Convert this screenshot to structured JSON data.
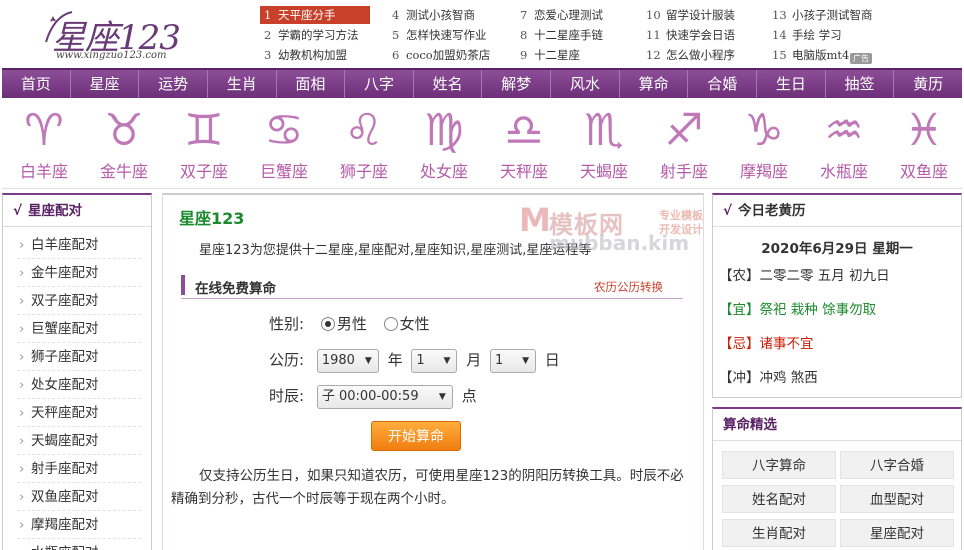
{
  "logo": {
    "text": "星座123",
    "url": "www.xingzuo123.com"
  },
  "top_links": [
    {
      "n": "1",
      "text": "天平座分手"
    },
    {
      "n": "2",
      "text": "学霸的学习方法"
    },
    {
      "n": "3",
      "text": "幼教机构加盟"
    },
    {
      "n": "4",
      "text": "测试小孩智商"
    },
    {
      "n": "5",
      "text": "怎样快速写作业"
    },
    {
      "n": "6",
      "text": "coco加盟奶茶店"
    },
    {
      "n": "7",
      "text": "恋爱心理测试"
    },
    {
      "n": "8",
      "text": "十二星座手链"
    },
    {
      "n": "9",
      "text": "十二星座"
    },
    {
      "n": "10",
      "text": "留学设计服装"
    },
    {
      "n": "11",
      "text": "快速学会日语"
    },
    {
      "n": "12",
      "text": "怎么做小程序"
    },
    {
      "n": "13",
      "text": "小孩子测试智商"
    },
    {
      "n": "14",
      "text": "手绘 学习"
    },
    {
      "n": "15",
      "text": "电脑版mt4"
    }
  ],
  "ad_mark": "广告",
  "nav": [
    "首页",
    "星座",
    "运势",
    "生肖",
    "面相",
    "八字",
    "姓名",
    "解梦",
    "风水",
    "算命",
    "合婚",
    "生日",
    "抽签",
    "黄历"
  ],
  "zodiac": [
    {
      "symbol": "♈",
      "name": "白羊座"
    },
    {
      "symbol": "♉",
      "name": "金牛座"
    },
    {
      "symbol": "♊",
      "name": "双子座"
    },
    {
      "symbol": "♋",
      "name": "巨蟹座"
    },
    {
      "symbol": "♌",
      "name": "狮子座"
    },
    {
      "symbol": "♍",
      "name": "处女座"
    },
    {
      "symbol": "♎",
      "name": "天秤座"
    },
    {
      "symbol": "♏",
      "name": "天蝎座"
    },
    {
      "symbol": "♐",
      "name": "射手座"
    },
    {
      "symbol": "♑",
      "name": "摩羯座"
    },
    {
      "symbol": "♒",
      "name": "水瓶座"
    },
    {
      "symbol": "♓",
      "name": "双鱼座"
    }
  ],
  "left_box": {
    "tick": "√",
    "title": "星座配对",
    "items": [
      "白羊座配对",
      "金牛座配对",
      "双子座配对",
      "巨蟹座配对",
      "狮子座配对",
      "处女座配对",
      "天秤座配对",
      "天蝎座配对",
      "射手座配对",
      "双鱼座配对",
      "摩羯座配对",
      "水瓶座配对"
    ]
  },
  "center": {
    "title": "星座123",
    "intro": "星座123为您提供十二星座,星座配对,星座知识,星座测试,星座运程等",
    "section_title": "在线免费算命",
    "convert_link": "农历公历转换",
    "gender_label": "性别:",
    "male": "男性",
    "female": "女性",
    "birth_label": "公历:",
    "year": "1980",
    "year_unit": "年",
    "month": "1",
    "month_unit": "月",
    "day": "1",
    "day_unit": "日",
    "hour_label": "时辰:",
    "hour": "子 00:00-00:59",
    "hour_unit": "点",
    "submit": "开始算命",
    "note": "仅支持公历生日，如果只知道农历，可使用星座123的阴阳历转换工具。时辰不必精确到分秒，古代一个时辰等于现在两个小时。"
  },
  "watermark": {
    "m": "M",
    "cn": "模板网",
    "sub1": "专业模板",
    "sub2": "开发设计",
    "url": "mubban.kim"
  },
  "almanac": {
    "tick": "√",
    "title": "今日老黄历",
    "date": "2020年6月29日 星期一",
    "nong_tag": "【农】",
    "nong": "二零二零 五月 初九日",
    "yi_tag": "【宜】",
    "yi": "祭祀 栽种 馀事勿取",
    "ji_tag": "【忌】",
    "ji": "诸事不宜",
    "chong_tag": "【冲】",
    "chong": "冲鸡 煞西"
  },
  "tools": {
    "title": "算命精选",
    "items": [
      "八字算命",
      "八字合婚",
      "姓名配对",
      "血型配对",
      "生肖配对",
      "星座配对"
    ]
  }
}
